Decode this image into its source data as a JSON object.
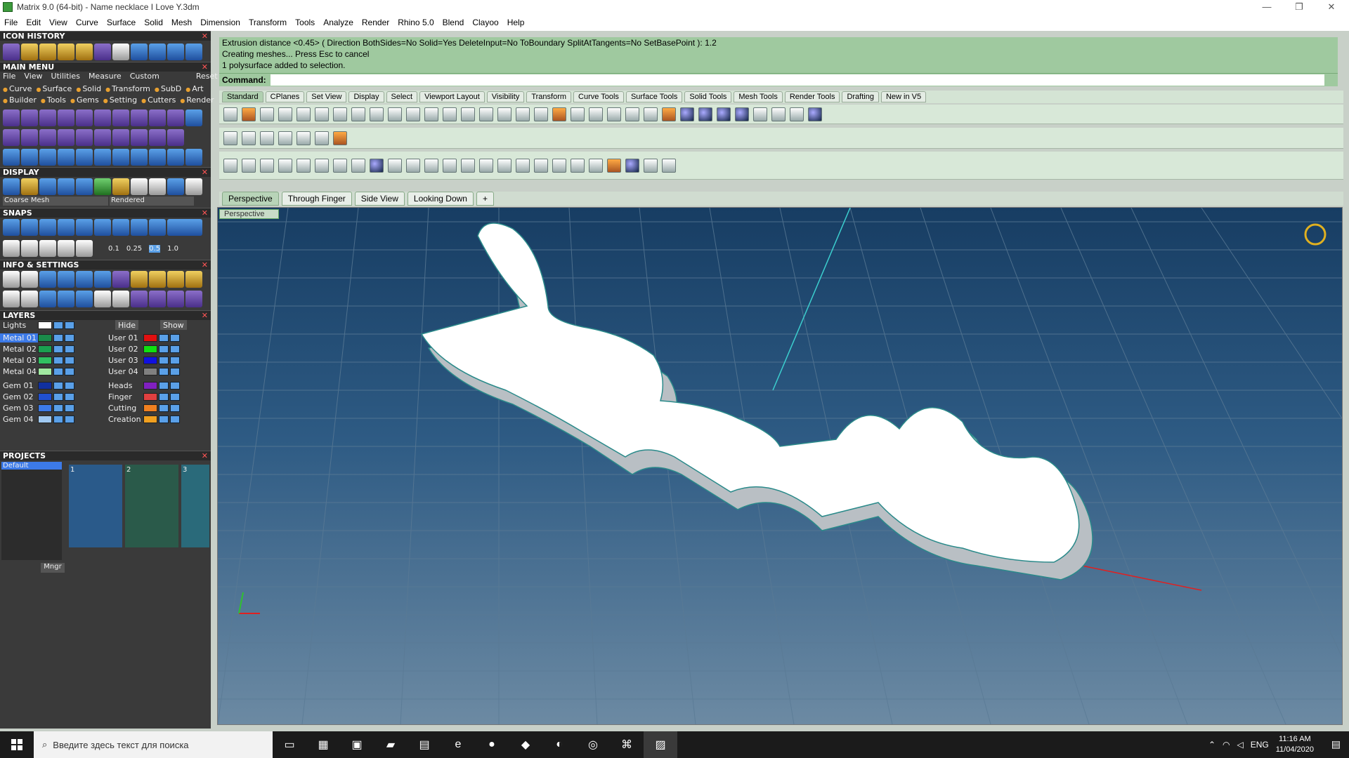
{
  "window": {
    "title": "Matrix 9.0 (64-bit) - Name necklace I Love Y.3dm",
    "min": "—",
    "restore": "❐",
    "close": "✕"
  },
  "menu": [
    "File",
    "Edit",
    "View",
    "Curve",
    "Surface",
    "Solid",
    "Mesh",
    "Dimension",
    "Transform",
    "Tools",
    "Analyze",
    "Render",
    "Rhino 5.0",
    "Blend",
    "Clayoo",
    "Help"
  ],
  "left": {
    "icon_history": "ICON HISTORY",
    "main_menu": "MAIN MENU",
    "mm_menu": [
      "File",
      "View",
      "Utilities",
      "Measure",
      "Custom"
    ],
    "mm_reset": "Reset",
    "cats1": [
      "Curve",
      "Surface",
      "Solid",
      "Transform",
      "SubD",
      "Art"
    ],
    "cats2": [
      "Builder",
      "Tools",
      "Gems",
      "Setting",
      "Cutters",
      "Render"
    ],
    "display": "DISPLAY",
    "display_mode1": "Coarse Mesh",
    "display_mode2": "Rendered",
    "snaps": "SNAPS",
    "snap_vals": [
      "0.1",
      "0.25",
      "0.5",
      "1.0"
    ],
    "info": "INFO & SETTINGS",
    "layers": "LAYERS",
    "lights": "Lights",
    "hide": "Hide",
    "show": "Show",
    "layers_left": [
      {
        "name": "Metal 01",
        "color": "#1a8a4a"
      },
      {
        "name": "Metal 02",
        "color": "#1aa050"
      },
      {
        "name": "Metal 03",
        "color": "#30c060"
      },
      {
        "name": "Metal 04",
        "color": "#a0e8a0"
      },
      {
        "name": "Gem 01",
        "color": "#1030a0"
      },
      {
        "name": "Gem 02",
        "color": "#2050d0"
      },
      {
        "name": "Gem 03",
        "color": "#3c7ae8"
      },
      {
        "name": "Gem 04",
        "color": "#a0c8f0"
      }
    ],
    "layers_right": [
      {
        "name": "User 01",
        "color": "#e01010"
      },
      {
        "name": "User 02",
        "color": "#10e010"
      },
      {
        "name": "User 03",
        "color": "#1010e0"
      },
      {
        "name": "User 04",
        "color": "#808080"
      },
      {
        "name": "Heads",
        "color": "#8020c0"
      },
      {
        "name": "Finger",
        "color": "#e04040"
      },
      {
        "name": "Cutting",
        "color": "#f08020"
      },
      {
        "name": "Creation",
        "color": "#f0a020"
      }
    ],
    "projects": "PROJECTS",
    "project_default": "Default",
    "project_nums": [
      "1",
      "2",
      "3"
    ],
    "mngr": "Mngr"
  },
  "command": {
    "line1": "Extrusion distance <0.45> ( Direction  BothSides=No  Solid=Yes  DeleteInput=No  ToBoundary  SplitAtTangents=No  SetBasePoint ): 1.2",
    "line2": "Creating meshes... Press Esc to cancel",
    "line3": "1 polysurface added to selection.",
    "label": "Command:"
  },
  "tabs": [
    "Standard",
    "CPlanes",
    "Set View",
    "Display",
    "Select",
    "Viewport Layout",
    "Visibility",
    "Transform",
    "Curve Tools",
    "Surface Tools",
    "Solid Tools",
    "Mesh Tools",
    "Render Tools",
    "Drafting",
    "New in V5"
  ],
  "viewport_tabs": [
    "Perspective",
    "Through Finger",
    "Side View",
    "Looking Down"
  ],
  "viewport_add": "+",
  "viewport_label": "Perspective",
  "model_text": "Love you",
  "taskbar": {
    "search": "Введите здесь текст для поиска",
    "lang": "ENG",
    "time": "11:16 AM",
    "date": "11/04/2020"
  }
}
